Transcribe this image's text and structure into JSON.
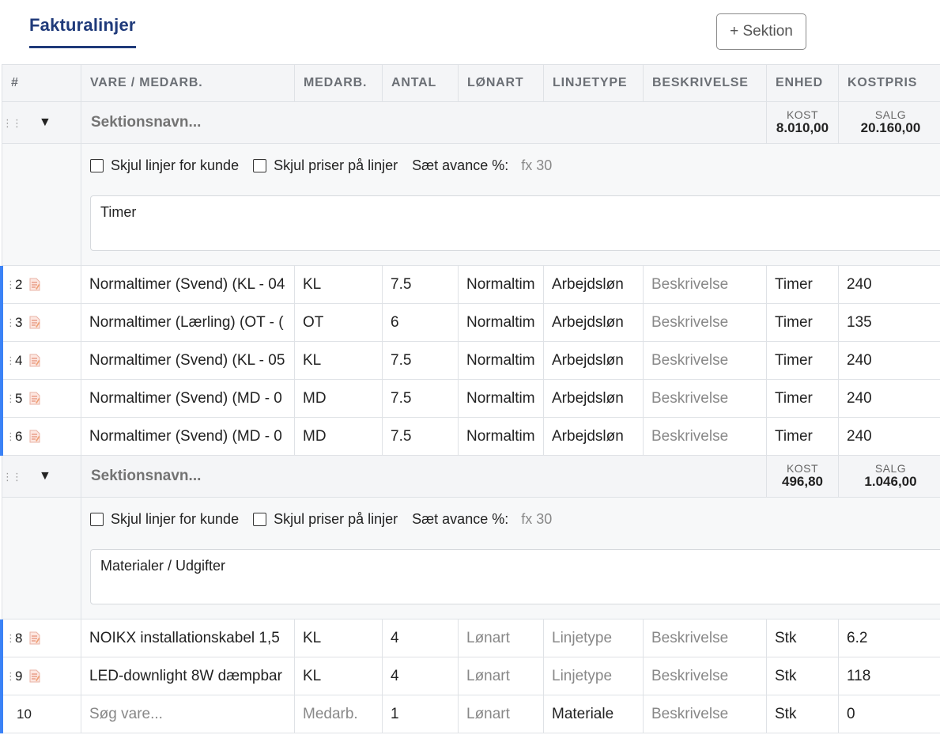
{
  "header": {
    "title": "Fakturalinjer",
    "add_section_label": "+ Sektion"
  },
  "columns": [
    "#",
    "VARE / MEDARB.",
    "MEDARB.",
    "ANTAL",
    "LØNART",
    "LINJETYPE",
    "BESKRIVELSE",
    "ENHED",
    "KOSTPRIS"
  ],
  "section_option_labels": {
    "hide_lines": "Skjul linjer for kunde",
    "hide_prices": "Skjul priser på linjer",
    "set_markup": "Sæt avance %:",
    "markup_placeholder": "fx 30"
  },
  "sections": [
    {
      "name_placeholder": "Sektionsnavn...",
      "cost_label": "KOST",
      "cost": "8.010,00",
      "sale_label": "SALG",
      "sale": "20.160,00",
      "text": "Timer",
      "rows": [
        {
          "num": "2",
          "item": "Normaltimer (Svend) (KL - 04",
          "emp": "KL",
          "qty": "7.5",
          "wage": "Normaltim",
          "type": "Arbejdsløn",
          "desc": "Beskrivelse",
          "unit": "Timer",
          "cost": "240"
        },
        {
          "num": "3",
          "item": "Normaltimer (Lærling) (OT - (",
          "emp": "OT",
          "qty": "6",
          "wage": "Normaltim",
          "type": "Arbejdsløn",
          "desc": "Beskrivelse",
          "unit": "Timer",
          "cost": "135"
        },
        {
          "num": "4",
          "item": "Normaltimer (Svend) (KL - 05",
          "emp": "KL",
          "qty": "7.5",
          "wage": "Normaltim",
          "type": "Arbejdsløn",
          "desc": "Beskrivelse",
          "unit": "Timer",
          "cost": "240"
        },
        {
          "num": "5",
          "item": "Normaltimer (Svend) (MD - 0",
          "emp": "MD",
          "qty": "7.5",
          "wage": "Normaltim",
          "type": "Arbejdsløn",
          "desc": "Beskrivelse",
          "unit": "Timer",
          "cost": "240"
        },
        {
          "num": "6",
          "item": "Normaltimer (Svend) (MD - 0",
          "emp": "MD",
          "qty": "7.5",
          "wage": "Normaltim",
          "type": "Arbejdsløn",
          "desc": "Beskrivelse",
          "unit": "Timer",
          "cost": "240"
        }
      ]
    },
    {
      "name_placeholder": "Sektionsnavn...",
      "cost_label": "KOST",
      "cost": "496,80",
      "sale_label": "SALG",
      "sale": "1.046,00",
      "text": "Materialer / Udgifter",
      "rows": [
        {
          "num": "8",
          "item": "NOIKX installationskabel 1,5",
          "emp": "KL",
          "qty": "4",
          "wage": "Lønart",
          "type": "Linjetype",
          "desc": "Beskrivelse",
          "unit": "Stk",
          "cost": "6.2"
        },
        {
          "num": "9",
          "item": "LED-downlight 8W dæmpbar",
          "emp": "KL",
          "qty": "4",
          "wage": "Lønart",
          "type": "Linjetype",
          "desc": "Beskrivelse",
          "unit": "Stk",
          "cost": "118"
        }
      ]
    }
  ],
  "new_row": {
    "num": "10",
    "item_placeholder": "Søg vare...",
    "emp_placeholder": "Medarb.",
    "qty": "1",
    "wage_placeholder": "Lønart",
    "type": "Materiale",
    "desc_placeholder": "Beskrivelse",
    "unit": "Stk",
    "cost": "0"
  },
  "colors": {
    "accent": "#1f3a7a",
    "row_marker": "#3b82f6"
  }
}
